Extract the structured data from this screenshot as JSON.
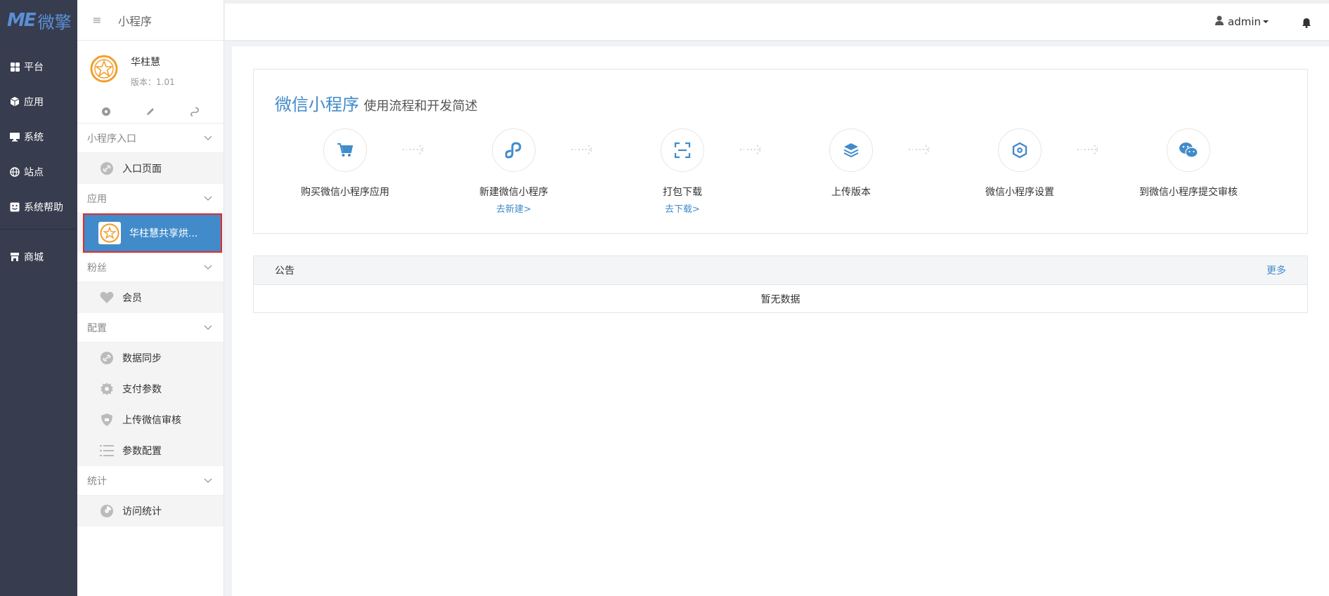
{
  "brand": {
    "mark": "ME",
    "name": "微擎"
  },
  "leftnav": [
    {
      "label": "平台",
      "icon": "grid-icon"
    },
    {
      "label": "应用",
      "icon": "cube-icon"
    },
    {
      "label": "系统",
      "icon": "monitor-icon"
    },
    {
      "label": "站点",
      "icon": "globe-icon"
    },
    {
      "label": "系统帮助",
      "icon": "help-icon"
    },
    {
      "label": "商城",
      "icon": "store-icon"
    }
  ],
  "subside": {
    "title": "小程序",
    "app": {
      "name": "华柱慧",
      "version": "版本：1.01"
    },
    "groups": [
      {
        "title": "小程序入口",
        "items": [
          {
            "label": "入口页面",
            "icon": "link-icon"
          }
        ]
      },
      {
        "title": "应用",
        "items": [
          {
            "label": "华柱慧共享烘...",
            "icon": "app-logo-icon",
            "active": true
          }
        ]
      },
      {
        "title": "粉丝",
        "items": [
          {
            "label": "会员",
            "icon": "heart-icon"
          }
        ]
      },
      {
        "title": "配置",
        "items": [
          {
            "label": "数据同步",
            "icon": "link-icon"
          },
          {
            "label": "支付参数",
            "icon": "gear-icon"
          },
          {
            "label": "上传微信审核",
            "icon": "shield-icon"
          },
          {
            "label": "参数配置",
            "icon": "list-icon"
          }
        ]
      },
      {
        "title": "统计",
        "items": [
          {
            "label": "访问统计",
            "icon": "pie-icon"
          }
        ]
      }
    ]
  },
  "topbar": {
    "user": "admin"
  },
  "flow": {
    "title_main": "微信小程序",
    "title_sub": "使用流程和开发简述",
    "steps": [
      {
        "label": "购买微信小程序应用",
        "link": "",
        "icon": "cart-icon"
      },
      {
        "label": "新建微信小程序",
        "link": "去新建>",
        "icon": "miniprogram-icon"
      },
      {
        "label": "打包下载",
        "link": "去下载>",
        "icon": "scan-icon"
      },
      {
        "label": "上传版本",
        "link": "",
        "icon": "layers-icon"
      },
      {
        "label": "微信小程序设置",
        "link": "",
        "icon": "hexagon-icon"
      },
      {
        "label": "到微信小程序提交审核",
        "link": "",
        "icon": "wechat-icon"
      }
    ]
  },
  "notice": {
    "title": "公告",
    "more": "更多",
    "empty": "暂无数据"
  },
  "colors": {
    "accent": "#428bca",
    "nav_bg": "#373d4e",
    "highlight_border": "#e02c2c"
  }
}
